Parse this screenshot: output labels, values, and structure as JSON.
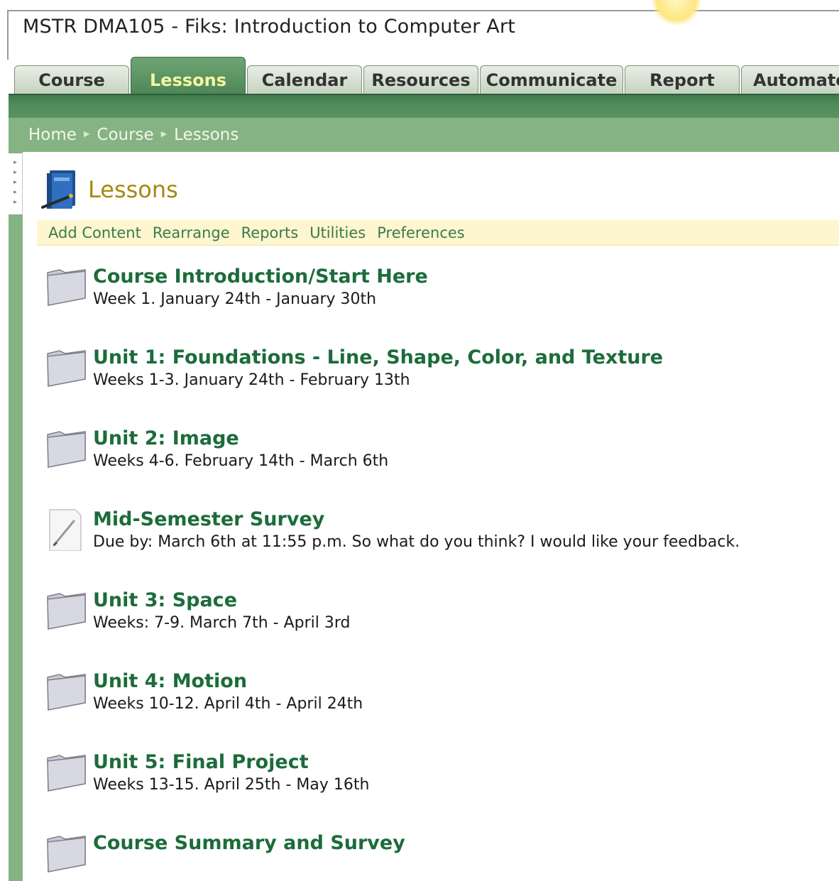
{
  "app": {
    "course_title": "MSTR DMA105 - Fiks: Introduction to Computer Art"
  },
  "tabs": [
    {
      "label": "Course",
      "active": false
    },
    {
      "label": "Lessons",
      "active": true
    },
    {
      "label": "Calendar",
      "active": false
    },
    {
      "label": "Resources",
      "active": false
    },
    {
      "label": "Communicate",
      "active": false
    },
    {
      "label": "Report",
      "active": false
    },
    {
      "label": "Automate",
      "active": false
    }
  ],
  "breadcrumb": [
    "Home",
    "Course",
    "Lessons"
  ],
  "page": {
    "heading": "Lessons",
    "icon": "lessons-book-icon"
  },
  "toolbar": [
    "Add Content",
    "Rearrange",
    "Reports",
    "Utilities",
    "Preferences"
  ],
  "lessons": [
    {
      "icon": "folder-icon",
      "title": "Course Introduction/Start Here",
      "subtitle": "Week 1. January 24th - January 30th"
    },
    {
      "icon": "folder-icon",
      "title": "Unit 1: Foundations - Line, Shape, Color, and Texture",
      "subtitle": "Weeks 1-3. January 24th - February 13th"
    },
    {
      "icon": "folder-icon",
      "title": "Unit 2: Image",
      "subtitle": "Weeks 4-6. February 14th - March 6th"
    },
    {
      "icon": "survey-pencil-icon",
      "title": "Mid-Semester Survey",
      "subtitle": "Due by: March 6th at 11:55 p.m. So what do you think? I would like your feedback."
    },
    {
      "icon": "folder-icon",
      "title": "Unit 3: Space",
      "subtitle": "Weeks: 7-9. March 7th - April 3rd"
    },
    {
      "icon": "folder-icon",
      "title": "Unit 4: Motion",
      "subtitle": "Weeks 10-12. April 4th - April 24th"
    },
    {
      "icon": "folder-icon",
      "title": "Unit 5: Final Project",
      "subtitle": "Weeks 13-15. April 25th - May 16th"
    },
    {
      "icon": "folder-icon",
      "title": "Course Summary and Survey",
      "subtitle": ""
    }
  ],
  "colors": {
    "tab_active": "#5a9362",
    "tab_active_text": "#f5f5a0",
    "breadcrumb_bar": "#86b383",
    "heading": "#a7890f",
    "lesson_title": "#1c6c3a",
    "toolbar_bg": "#fdf6cf"
  }
}
